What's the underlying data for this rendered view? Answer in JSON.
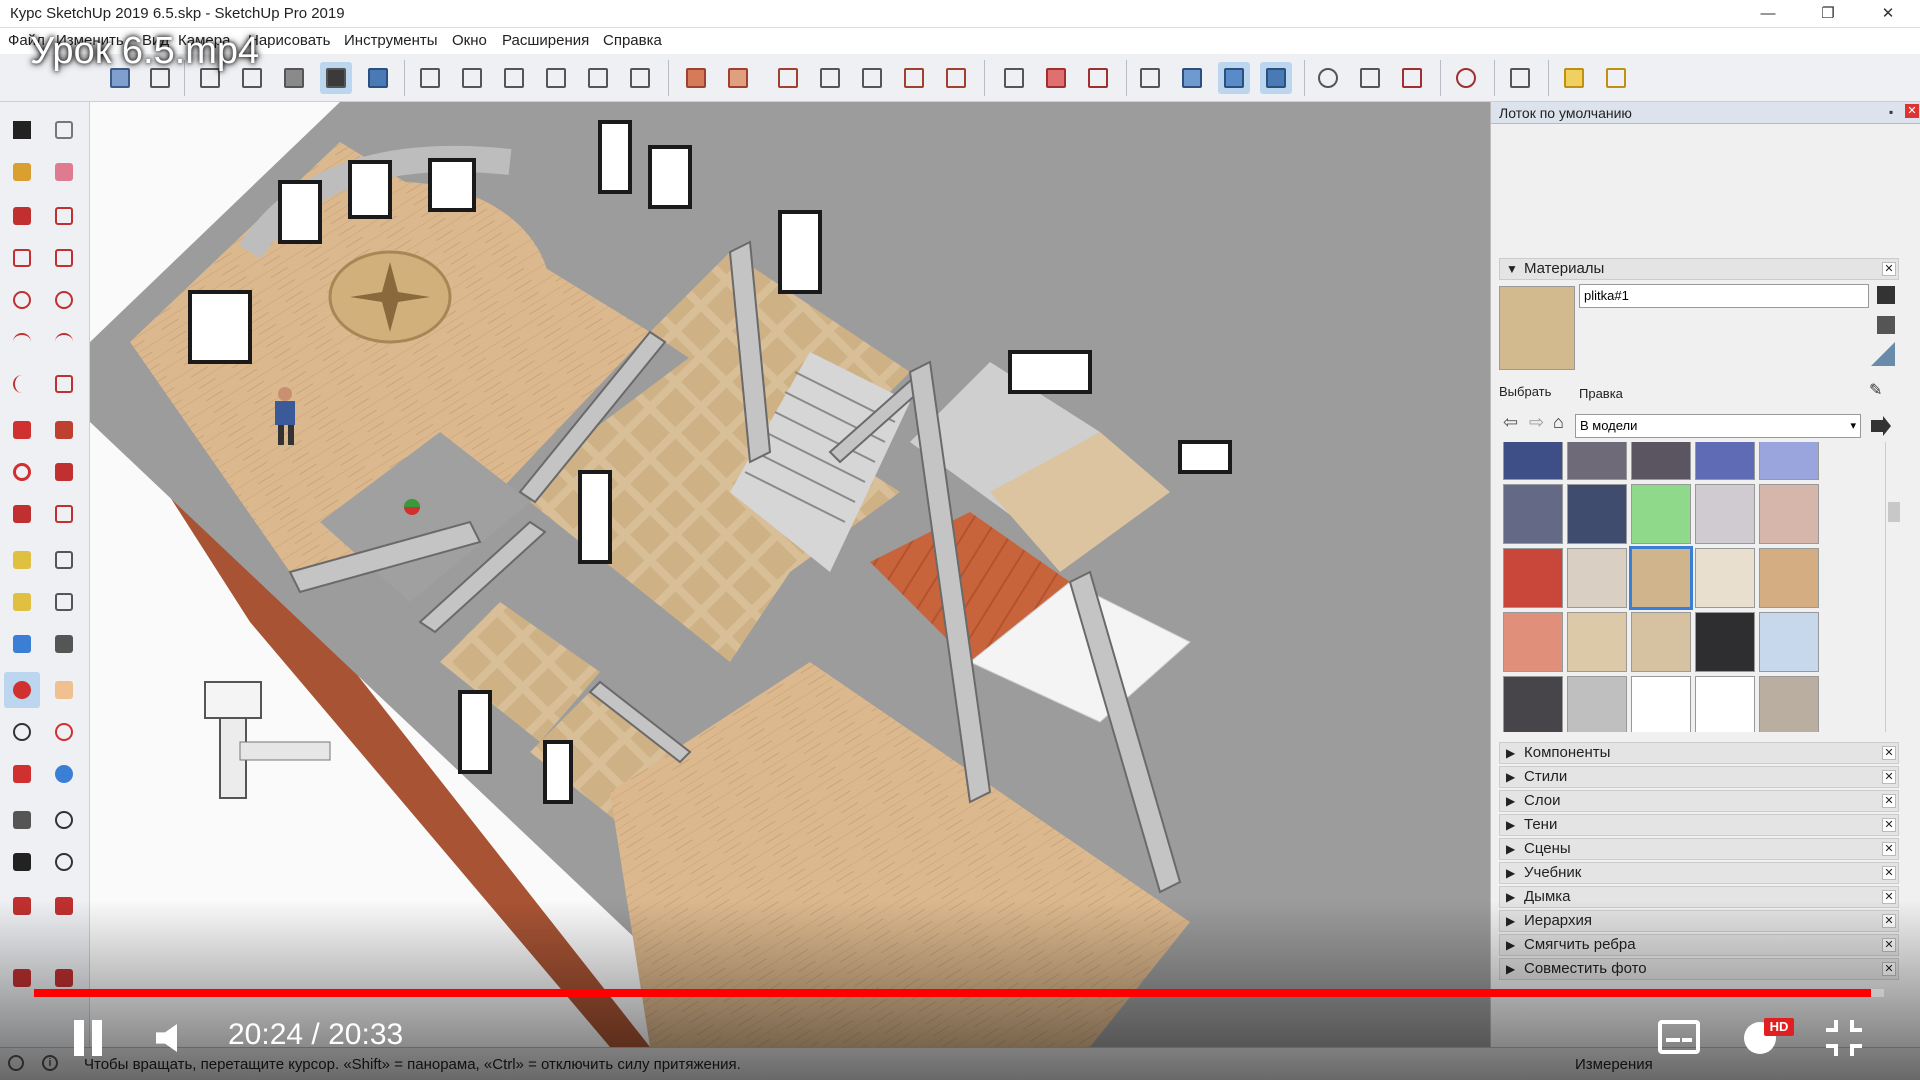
{
  "window": {
    "title": "Курс SketchUp 2019 6.5.skp - SketchUp Pro 2019",
    "minimize": "—",
    "maximize": "❐",
    "close": "✕"
  },
  "video_title": "Урок 6.5.mp4",
  "menu": [
    "Файл",
    "Изменить",
    "Вид",
    "Камера",
    "Нарисовать",
    "Инструменты",
    "Окно",
    "Расширения",
    "Справка"
  ],
  "tray": {
    "title": "Лоток по умолчанию",
    "materials": {
      "header": "Материалы",
      "material_name": "plitka#1",
      "tab_select": "Выбрать",
      "tab_edit": "Правка",
      "library": "В модели",
      "swatches": [
        [
          "#3d4f86",
          "#6e6a77",
          "#5a5560",
          "#5f6bb5",
          "#9aa5dd"
        ],
        [
          "#646a86",
          "#3f4c6e",
          "#8fd98a",
          "#cfcbd0",
          "#d6b6aa"
        ],
        [
          "#c8473a",
          "#d9cfc2",
          "#cfb48c",
          "#e8dfcf",
          "#d4ad82"
        ],
        [
          "#e0907a",
          "#dcc9a8",
          "#d6c2a0",
          "#2e2e30",
          "#c8d8ec"
        ],
        [
          "#474549",
          "#bfbfbf",
          "#ffffff",
          "#ffffff",
          "#b9aea0"
        ],
        [
          "#b9cf5a",
          "#9d5a46",
          "#b59a4e",
          "#e8e8e4",
          "#c9a98a"
        ]
      ]
    },
    "panels": [
      "Компоненты",
      "Стили",
      "Слои",
      "Тени",
      "Сцены",
      "Учебник",
      "Дымка",
      "Иерархия",
      "Смягчить ребра",
      "Совместить фото"
    ]
  },
  "status": {
    "message": "Чтобы вращать, перетащите курсор. «Shift» = панорама, «Ctrl» = отключить силу притяжения.",
    "measurements_label": "Измерения"
  },
  "player": {
    "current_time": "20:24",
    "separator": "/",
    "duration": "20:33",
    "progress": 0.993,
    "hd_badge": "HD"
  },
  "colors": {
    "accent": "#3a7fd5",
    "progress_red": "#ff0000",
    "floor_wood": "#d9b48a",
    "wall": "#9a9a9a"
  }
}
